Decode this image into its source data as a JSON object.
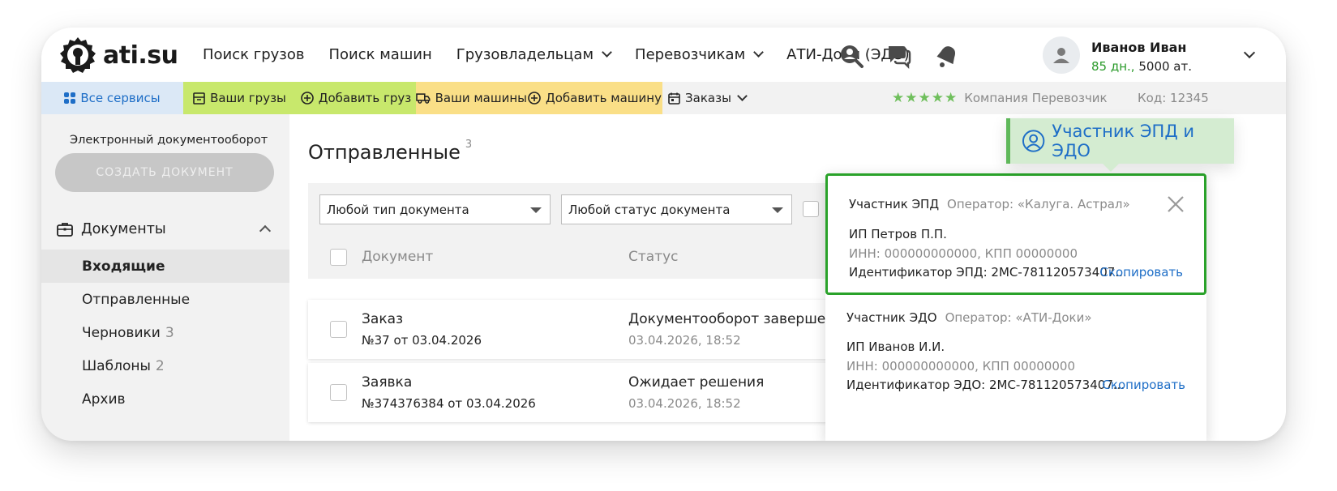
{
  "header": {
    "logo_text": "ati.su",
    "nav": [
      {
        "label": "Поиск грузов",
        "has_dropdown": false
      },
      {
        "label": "Поиск машин",
        "has_dropdown": false
      },
      {
        "label": "Грузовладельцам",
        "has_dropdown": true
      },
      {
        "label": "Перевозчикам",
        "has_dropdown": true
      },
      {
        "label": "АТИ-Доки (ЭДО)",
        "has_dropdown": false
      }
    ],
    "icons": [
      "search-user-icon",
      "chat-icon",
      "bell-icon"
    ],
    "user": {
      "name": "Иванов Иван",
      "days": "85 дн.,",
      "points": "5000 ат."
    }
  },
  "services": {
    "all": "Все сервисы",
    "your_cargo": "Ваши грузы",
    "add_cargo": "Добавить груз",
    "your_trucks": "Ваши машины",
    "add_truck": "Добавить машину",
    "orders": "Заказы",
    "stars": "★★★★★",
    "company": "Компания Перевозчик",
    "code": "Код: 12345",
    "colors": {
      "all": "#dbe8f6",
      "cargo": "#c8e86c",
      "trucks": "#fadf87",
      "stars": "#6fbf5c"
    }
  },
  "sidebar": {
    "title": "Электронный документооборот",
    "create_button": "СОЗДАТЬ ДОКУМЕНТ",
    "section": "Документы",
    "items": [
      {
        "label": "Входящие",
        "count": "",
        "active": true
      },
      {
        "label": "Отправленные",
        "count": "",
        "active": false
      },
      {
        "label": "Черновики",
        "count": "3",
        "active": false
      },
      {
        "label": "Шаблоны",
        "count": "2",
        "active": false
      },
      {
        "label": "Архив",
        "count": "",
        "active": false
      }
    ]
  },
  "main": {
    "title": "Отправленные",
    "title_count": "3",
    "filters": {
      "doc_type": "Любой тип документа",
      "doc_status": "Любой статус документа"
    },
    "columns": [
      "Документ",
      "Статус"
    ],
    "rows": [
      {
        "title": "Заказ",
        "number": "№37 от 03.04.2026",
        "status": "Документооборот завершен",
        "date": "03.04.2026, 18:52"
      },
      {
        "title": "Заявка",
        "number": "№374376384 от 03.04.2026",
        "status": "Ожидает решения",
        "date": "03.04.2026, 18:52"
      }
    ]
  },
  "badge": {
    "label": "Участник ЭПД и ЭДО",
    "accent": "#5fb85a"
  },
  "popup": {
    "epd": {
      "label": "Участник ЭПД",
      "operator": "Оператор: «Калуга. Астрал»",
      "name": "ИП Петров П.П.",
      "inn": "ИНН: 000000000000, КПП 00000000",
      "id": "Идентификатор ЭПД:  2МС-781120573407...",
      "copy": "Скопировать"
    },
    "edo": {
      "label": "Участник ЭДО",
      "operator": "Оператор: «АТИ-Доки»",
      "name": "ИП Иванов И.И.",
      "inn": "ИНН: 000000000000, КПП 00000000",
      "id": "Идентификатор ЭДО:  2МС-781120573407...",
      "copy": "Скопировать"
    },
    "border_color": "#2aa22a"
  }
}
